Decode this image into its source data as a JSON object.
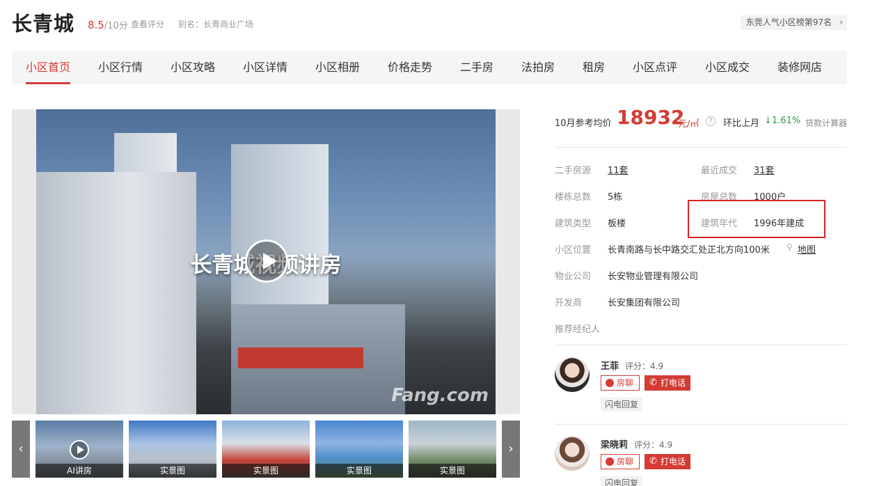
{
  "header": {
    "title": "长青城",
    "score_value": "8.5",
    "score_suffix": "/10分",
    "view_score": "查看评分",
    "alias": "别名：长青商业广场",
    "rank_badge": "东莞人气小区榜第97名",
    "rank_chevron": "›"
  },
  "nav": {
    "items": [
      {
        "label": "小区首页",
        "active": true
      },
      {
        "label": "小区行情"
      },
      {
        "label": "小区攻略"
      },
      {
        "label": "小区详情"
      },
      {
        "label": "小区相册"
      },
      {
        "label": "价格走势"
      },
      {
        "label": "二手房"
      },
      {
        "label": "法拍房"
      },
      {
        "label": "租房"
      },
      {
        "label": "小区点评"
      },
      {
        "label": "小区成交"
      },
      {
        "label": "装修网店"
      }
    ]
  },
  "media": {
    "video_title": "长青城视频讲房",
    "watermark": "Fang.com",
    "thumbs": [
      {
        "caption": "AI讲房",
        "video": true
      },
      {
        "caption": "实景图"
      },
      {
        "caption": "实景图"
      },
      {
        "caption": "实景图"
      },
      {
        "caption": "实景图"
      }
    ],
    "prev_arrow": "‹",
    "next_arrow": "›"
  },
  "price": {
    "label": "10月参考均价",
    "value": "18932",
    "unit": "元/㎡",
    "help": "?",
    "mom_label": "环比上月",
    "mom_value": "↓1.61%",
    "loan_calc": "贷款计算器"
  },
  "details": {
    "second_hand_label": "二手房源",
    "second_hand_value": "11套",
    "recent_deal_label": "最近成交",
    "recent_deal_value": "31套",
    "buildings_label": "楼栋总数",
    "buildings_value": "5栋",
    "houses_label": "房屋总数",
    "houses_value": "1000户",
    "type_label": "建筑类型",
    "type_value": "板楼",
    "year_label": "建筑年代",
    "year_value": "1996年建成",
    "location_label": "小区位置",
    "location_value": "长青南路与长中路交汇处正北方向100米",
    "map_link": "地图",
    "property_label": "物业公司",
    "property_value": "长安物业管理有限公司",
    "developer_label": "开发商",
    "developer_value": "长安集团有限公司",
    "agents_label": "推荐经纪人"
  },
  "agents": [
    {
      "name": "王菲",
      "rating": "评分：4.9",
      "chat": "房聊",
      "call": "打电话",
      "reply": "闪电回复"
    },
    {
      "name": "梁晓莉",
      "rating": "评分：4.9",
      "chat": "房聊",
      "call": "打电话",
      "reply": "闪电回复"
    }
  ],
  "colors": {
    "accent": "#d43b33",
    "down": "#2ba245",
    "highlight": "#e02020"
  }
}
